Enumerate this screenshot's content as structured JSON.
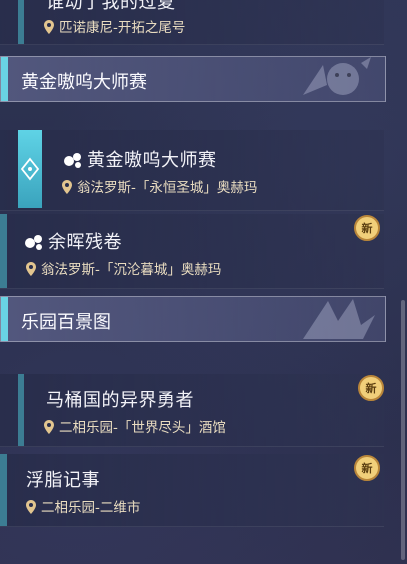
{
  "top_quest": {
    "title": "谁动了我的过夏",
    "location": "匹诺康尼-开拓之尾号"
  },
  "sections": [
    {
      "title": "黄金嗷呜大师赛"
    },
    {
      "title": "乐园百景图"
    }
  ],
  "quests": [
    {
      "title": "黄金嗷呜大师赛",
      "location": "翁法罗斯-「永恒圣城」奥赫玛",
      "selected": true,
      "icon": "paw-icon"
    },
    {
      "title": "余晖残卷",
      "location": "翁法罗斯-「沉沦暮城」奥赫玛",
      "badge": "新",
      "icon": "paw-icon"
    },
    {
      "title": "马桶国的异界勇者",
      "location": "二相乐园-「世界尽头」酒馆",
      "badge": "新"
    },
    {
      "title": "浮脂记事",
      "location": "二相乐园-二维市",
      "badge": "新"
    }
  ],
  "colors": {
    "accent": "#69d4e4",
    "bar": "#3c7d93",
    "location": "#e9dcc0",
    "badge": "#e7b65a"
  }
}
